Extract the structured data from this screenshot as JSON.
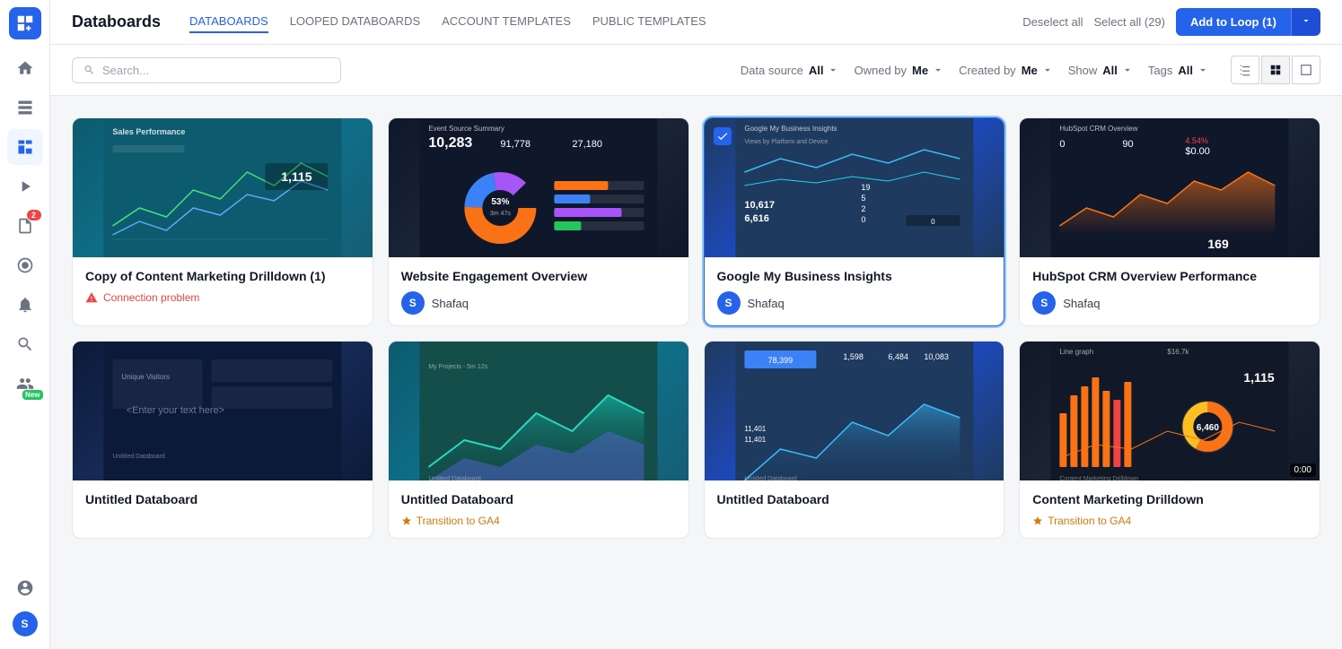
{
  "app": {
    "logo_label": "Databoards",
    "title": "Databoards"
  },
  "topnav": {
    "title": "Databoards",
    "links": [
      {
        "id": "databoards",
        "label": "DATABOARDS",
        "active": true
      },
      {
        "id": "looped",
        "label": "LOOPED DATABOARDS",
        "active": false
      },
      {
        "id": "account",
        "label": "ACCOUNT TEMPLATES",
        "active": false
      },
      {
        "id": "public",
        "label": "PUBLIC TEMPLATES",
        "active": false
      }
    ],
    "deselect_label": "Deselect all",
    "select_all_label": "Select all (29)",
    "add_to_loop_label": "Add to Loop (1)"
  },
  "filterbar": {
    "search_placeholder": "Search...",
    "data_source_label": "Data source",
    "data_source_value": "All",
    "owned_by_label": "Owned by",
    "owned_by_value": "Me",
    "created_by_label": "Created by",
    "created_by_value": "Me",
    "show_label": "Show",
    "show_value": "All",
    "tags_label": "Tags",
    "tags_value": "All"
  },
  "cards": [
    {
      "id": "card-1",
      "title": "Copy of Content Marketing Drilldown (1)",
      "thumb_class": "thumb-teal",
      "selected": false,
      "error": "Connection problem",
      "author": null,
      "tag": null
    },
    {
      "id": "card-2",
      "title": "Website Engagement Overview",
      "thumb_class": "thumb-dark",
      "selected": false,
      "error": null,
      "author": "Shafaq",
      "author_initial": "S",
      "tag": null
    },
    {
      "id": "card-3",
      "title": "Google My Business Insights",
      "thumb_class": "thumb-blue",
      "selected": true,
      "error": null,
      "author": "Shafaq",
      "author_initial": "S",
      "tag": null
    },
    {
      "id": "card-4",
      "title": "HubSpot CRM Overview Performance",
      "thumb_class": "thumb-dark",
      "selected": false,
      "error": null,
      "author": "Shafaq",
      "author_initial": "S",
      "tag": null
    },
    {
      "id": "card-5",
      "title": "Untitled Databoard",
      "thumb_class": "thumb-navy",
      "selected": false,
      "error": null,
      "author": null,
      "tag": null
    },
    {
      "id": "card-6",
      "title": "Untitled Databoard",
      "thumb_class": "thumb-teal",
      "selected": false,
      "error": null,
      "author": null,
      "tag": "Transition to GA4"
    },
    {
      "id": "card-7",
      "title": "Untitled Databoard",
      "thumb_class": "thumb-blue",
      "selected": false,
      "error": null,
      "author": null,
      "tag": null
    },
    {
      "id": "card-8",
      "title": "Content Marketing Drilldown",
      "thumb_class": "thumb-black",
      "selected": false,
      "error": null,
      "author": null,
      "tag": "Transition to GA4"
    }
  ],
  "sidebar": {
    "icons": [
      {
        "name": "home-icon",
        "unicode": "⌂"
      },
      {
        "name": "numbers-icon",
        "unicode": ""
      },
      {
        "name": "chart-icon",
        "unicode": ""
      },
      {
        "name": "play-icon",
        "unicode": ""
      },
      {
        "name": "reports-icon",
        "unicode": ""
      },
      {
        "name": "goals-icon",
        "unicode": ""
      },
      {
        "name": "alerts-icon",
        "unicode": ""
      },
      {
        "name": "search-icon",
        "unicode": ""
      },
      {
        "name": "users-icon",
        "unicode": ""
      },
      {
        "name": "profile-icon",
        "unicode": ""
      },
      {
        "name": "user-circle-icon",
        "unicode": ""
      }
    ],
    "badge_count": "2",
    "badge_new": "New"
  },
  "time_badge": "0:00"
}
